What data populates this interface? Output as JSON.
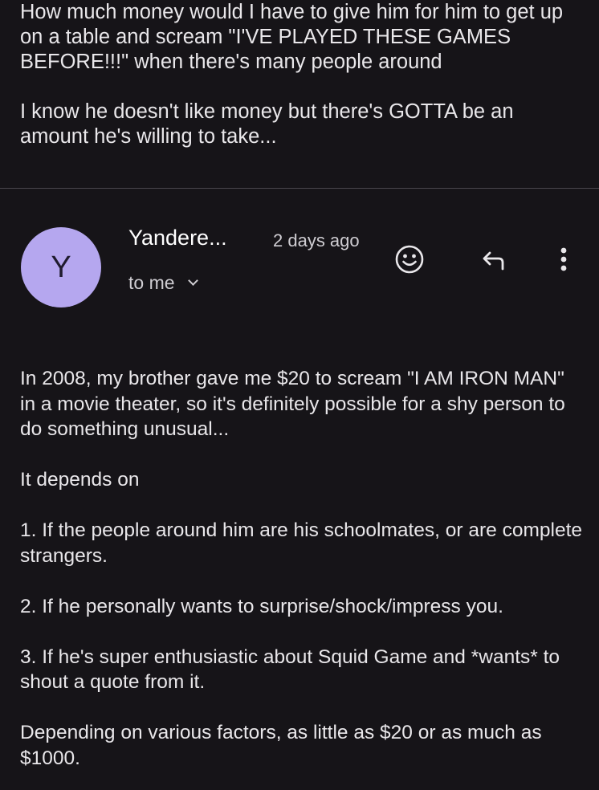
{
  "quoted_message": {
    "paragraphs": [
      "How much money would I have to give him for him to get up on a table and scream \"I'VE PLAYED THESE GAMES BEFORE!!!\" when there's many people around",
      "I know he doesn't like money but there's GOTTA be an amount he's willing to take..."
    ]
  },
  "reply": {
    "avatar_letter": "Y",
    "sender": "Yandere...",
    "time": "2 days ago",
    "recipient": "to me",
    "icons": {
      "emoji": "smiley-face-icon",
      "reply": "reply-arrow-icon",
      "more": "more-vertical-icon"
    },
    "colors": {
      "avatar": "#b5a7ef",
      "background": "#161418"
    },
    "paragraphs": [
      "In 2008, my brother gave me $20 to scream \"I AM IRON MAN\" in a movie theater, so it's definitely possible for a shy person to do something unusual...",
      "It depends on",
      "1. If the people around him are his schoolmates, or are complete strangers.",
      "2. If he personally wants to surprise/shock/impress you.",
      "3. If he's super enthusiastic about Squid Game and *wants* to shout a quote from it.",
      "Depending on various factors, as little as $20 or as much as $1000."
    ]
  }
}
